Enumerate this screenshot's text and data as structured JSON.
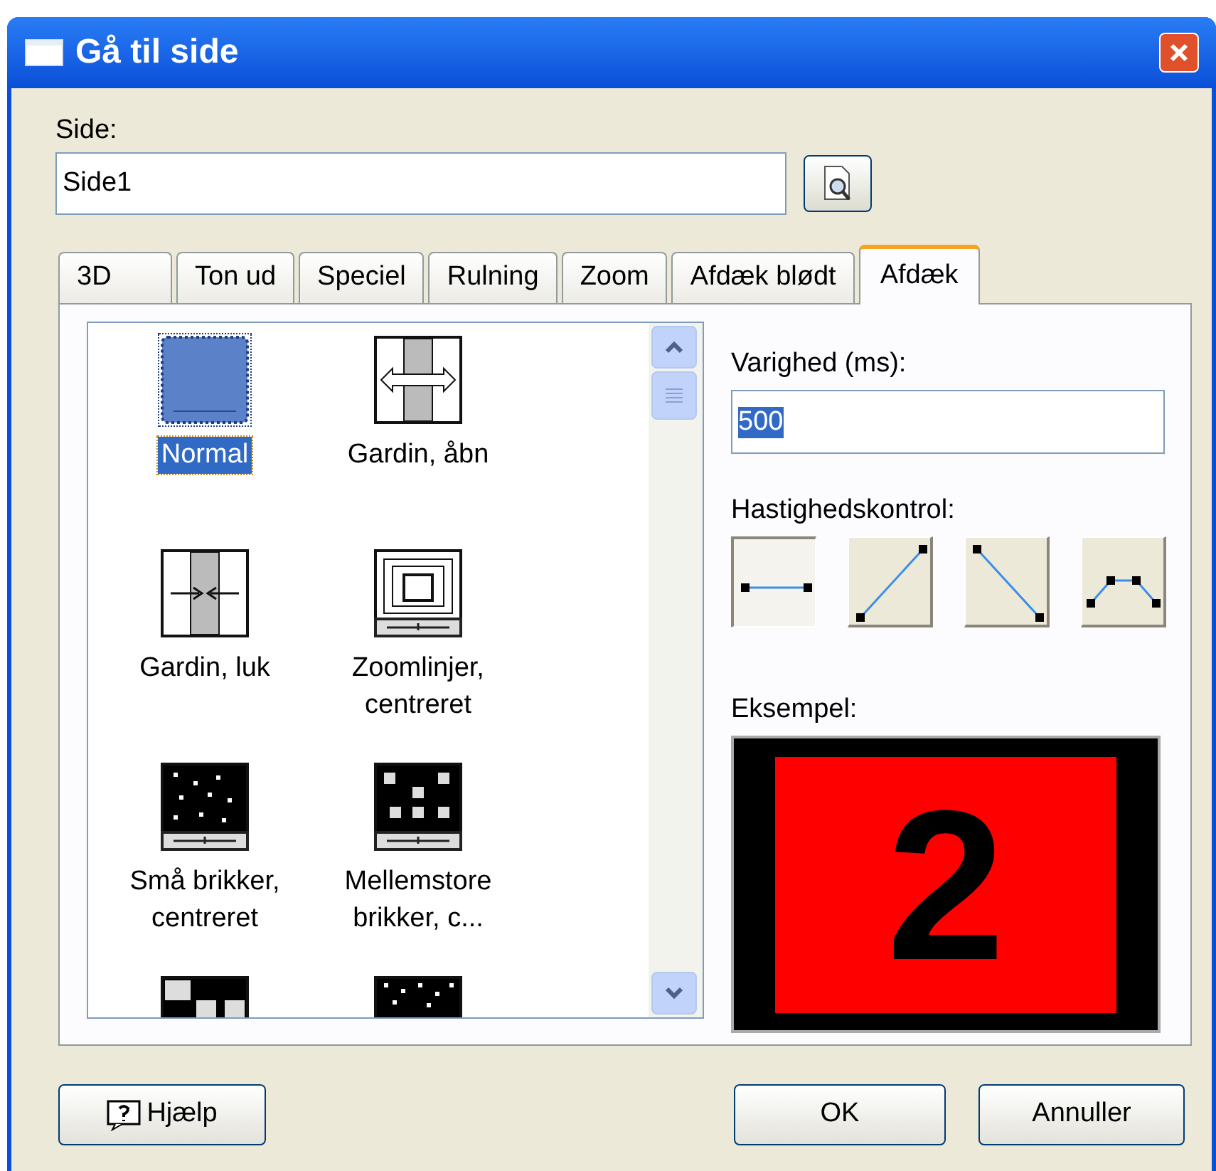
{
  "window": {
    "title": "Gå til side"
  },
  "page_field": {
    "label": "Side:",
    "value": "Side1"
  },
  "tabs": [
    {
      "label": "3D",
      "selected": false
    },
    {
      "label": "Ton ud",
      "selected": false
    },
    {
      "label": "Speciel",
      "selected": false
    },
    {
      "label": "Rulning",
      "selected": false
    },
    {
      "label": "Zoom",
      "selected": false
    },
    {
      "label": "Afdæk blødt",
      "selected": false
    },
    {
      "label": "Afdæk",
      "selected": true
    }
  ],
  "effects": [
    {
      "kind": "solid",
      "label": "Normal",
      "selected": true
    },
    {
      "kind": "curtain-open",
      "label": "Gardin, åbn",
      "selected": false
    },
    {
      "kind": "curtain-close",
      "label": "Gardin, luk",
      "selected": false
    },
    {
      "kind": "zoom-lines",
      "label": "Zoomlinjer, centreret",
      "selected": false
    },
    {
      "kind": "small-tiles",
      "label": "Små brikker, centreret",
      "selected": false
    },
    {
      "kind": "medium-tiles",
      "label": "Mellemstore brikker, c...",
      "selected": false
    },
    {
      "kind": "large-tiles",
      "selected": false
    },
    {
      "kind": "dots",
      "selected": false
    }
  ],
  "duration": {
    "label": "Varighed (ms):",
    "value": "500"
  },
  "speed_control": {
    "label": "Hastighedskontrol:",
    "options": [
      {
        "kind": "flat",
        "selected": true
      },
      {
        "kind": "up",
        "selected": false
      },
      {
        "kind": "down",
        "selected": false
      },
      {
        "kind": "hump",
        "selected": false
      }
    ]
  },
  "example": {
    "label": "Eksempel:",
    "text": "2"
  },
  "buttons": [
    {
      "kind": "help",
      "label": "Hjælp"
    },
    {
      "kind": "ok",
      "label": "OK"
    },
    {
      "kind": "cancel",
      "label": "Annuller"
    }
  ]
}
